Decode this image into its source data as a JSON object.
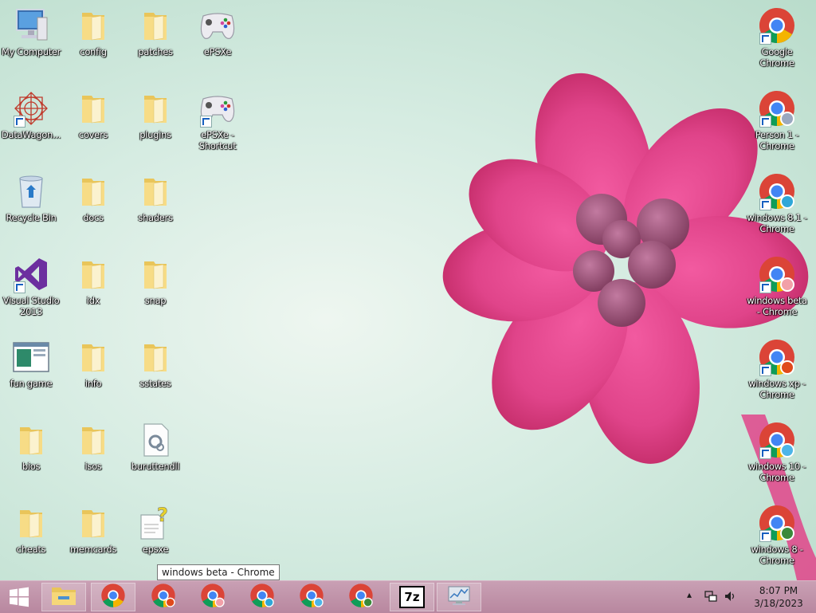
{
  "desktop": {
    "icons_left": [
      {
        "label": "My Computer",
        "icon": "computer-icon"
      },
      {
        "label": "config",
        "icon": "folder-icon"
      },
      {
        "label": "patches",
        "icon": "folder-icon"
      },
      {
        "label": "ePSXe",
        "icon": "gamepad-icon"
      },
      {
        "label": "DataWagon...",
        "icon": "datawagon-icon"
      },
      {
        "label": "covers",
        "icon": "folder-icon"
      },
      {
        "label": "plugins",
        "icon": "folder-icon"
      },
      {
        "label": "ePSXe - Shortcut",
        "icon": "gamepad-icon"
      },
      {
        "label": "Recycle Bin",
        "icon": "recycle-bin-icon"
      },
      {
        "label": "docs",
        "icon": "folder-icon"
      },
      {
        "label": "shaders",
        "icon": "folder-icon"
      },
      {
        "label": "Visual Studio 2013",
        "icon": "visual-studio-icon"
      },
      {
        "label": "idx",
        "icon": "folder-icon"
      },
      {
        "label": "snap",
        "icon": "folder-icon"
      },
      {
        "label": "fun game",
        "icon": "window-app-icon"
      },
      {
        "label": "info",
        "icon": "folder-icon"
      },
      {
        "label": "sstates",
        "icon": "folder-icon"
      },
      {
        "label": "bios",
        "icon": "folder-icon"
      },
      {
        "label": "isos",
        "icon": "folder-icon"
      },
      {
        "label": "buruttendll",
        "icon": "settings-file-icon"
      },
      {
        "label": "cheats",
        "icon": "folder-icon"
      },
      {
        "label": "memcards",
        "icon": "folder-icon"
      },
      {
        "label": "epsxe",
        "icon": "help-file-icon"
      }
    ],
    "icons_right": [
      {
        "label": "Google Chrome",
        "icon": "chrome-icon",
        "badge": ""
      },
      {
        "label": "Person 1 - Chrome",
        "icon": "chrome-icon",
        "badge": "person"
      },
      {
        "label": "windows 8.1 - Chrome",
        "icon": "chrome-icon",
        "badge": "blue"
      },
      {
        "label": "windows beta - Chrome",
        "icon": "chrome-icon",
        "badge": "pink"
      },
      {
        "label": "windows xp - Chrome",
        "icon": "chrome-icon",
        "badge": "orange"
      },
      {
        "label": "windows 10 - Chrome",
        "icon": "chrome-icon",
        "badge": "face"
      },
      {
        "label": "windows 8 - Chrome",
        "icon": "chrome-icon",
        "badge": "green"
      }
    ]
  },
  "tooltip": "windows beta - Chrome",
  "taskbar": {
    "start_icon": "windows-logo-icon",
    "buttons": [
      {
        "name": "file-explorer",
        "icon": "file-explorer-icon"
      },
      {
        "name": "chrome",
        "icon": "chrome-icon"
      },
      {
        "name": "chrome-profile-1",
        "icon": "chrome-icon"
      },
      {
        "name": "chrome-profile-2",
        "icon": "chrome-icon"
      },
      {
        "name": "chrome-profile-3",
        "icon": "chrome-icon"
      },
      {
        "name": "chrome-profile-4",
        "icon": "chrome-icon"
      },
      {
        "name": "chrome-profile-5",
        "icon": "chrome-icon"
      },
      {
        "name": "7zip",
        "icon": "7zip-icon",
        "text": "7z"
      },
      {
        "name": "resource-monitor",
        "icon": "monitor-icon"
      }
    ],
    "tray": {
      "time": "8:07 PM",
      "date": "3/18/2023"
    }
  },
  "colors": {
    "taskbar": "#b8879f",
    "flower": "#e0448a",
    "background": "#d6ece2"
  }
}
